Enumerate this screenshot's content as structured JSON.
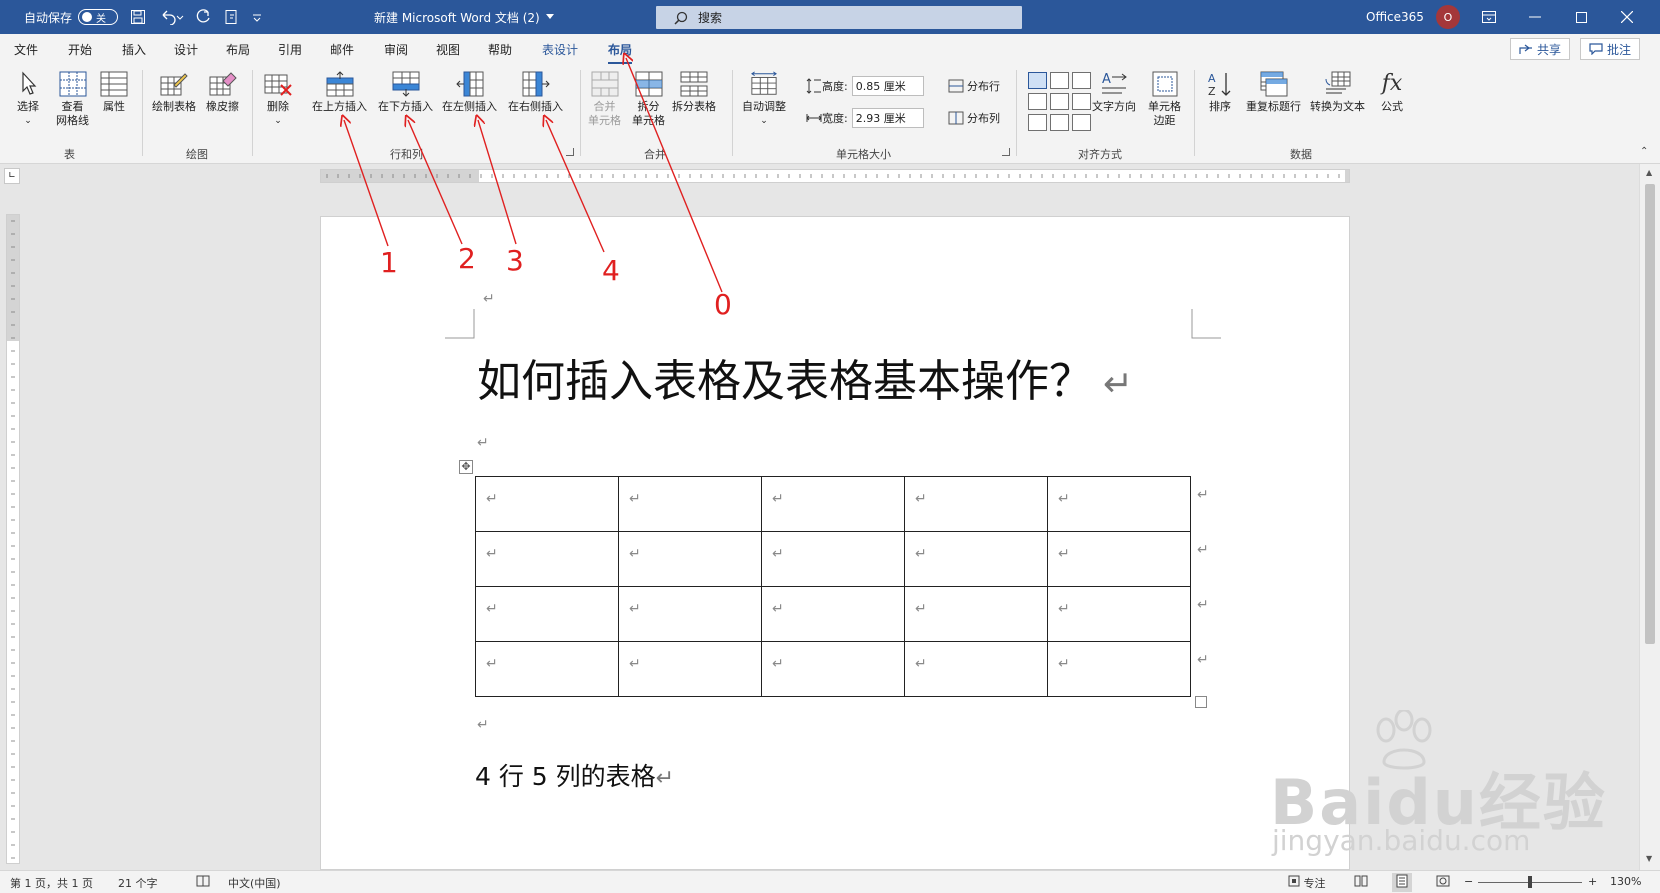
{
  "titlebar": {
    "autosave_label": "自动保存",
    "autosave_state": "关",
    "doc_title": "新建 Microsoft Word 文档 (2)",
    "search_placeholder": "搜索",
    "account": "Office365",
    "avatar_initial": "O"
  },
  "tabs": {
    "items": [
      "文件",
      "开始",
      "插入",
      "设计",
      "布局",
      "引用",
      "邮件",
      "审阅",
      "视图",
      "帮助",
      "表设计",
      "布局"
    ],
    "share": "共享",
    "comments": "批注"
  },
  "ribbon": {
    "table_group": {
      "label": "表",
      "select": "选择",
      "gridlines_1": "查看",
      "gridlines_2": "网格线",
      "properties": "属性"
    },
    "draw_group": {
      "label": "绘图",
      "draw_table": "绘制表格",
      "eraser": "橡皮擦"
    },
    "rows_cols_group": {
      "label": "行和列",
      "delete": "删除",
      "insert_above": "在上方插入",
      "insert_below": "在下方插入",
      "insert_left": "在左侧插入",
      "insert_right": "在右侧插入"
    },
    "merge_group": {
      "label": "合并",
      "merge_1": "合并",
      "merge_2": "单元格",
      "split_cells_1": "拆分",
      "split_cells_2": "单元格",
      "split_table": "拆分表格"
    },
    "cell_size_group": {
      "label": "单元格大小",
      "autofit": "自动调整",
      "height_label": "高度:",
      "height_value": "0.85 厘米",
      "width_label": "宽度:",
      "width_value": "2.93 厘米",
      "distribute_rows": "分布行",
      "distribute_cols": "分布列"
    },
    "alignment_group": {
      "label": "对齐方式",
      "text_direction": "文字方向",
      "cell_margins_1": "单元格",
      "cell_margins_2": "边距"
    },
    "data_group": {
      "label": "数据",
      "sort": "排序",
      "repeat_header": "重复标题行",
      "convert_text": "转换为文本",
      "formula": "公式"
    }
  },
  "document": {
    "title": "如何插入表格及表格基本操作？",
    "para_mark": "↵",
    "table": {
      "rows": 4,
      "cols": 5,
      "cell_text": "↵"
    },
    "caption": "4 行 5 列的表格"
  },
  "annotations": [
    "1",
    "2",
    "3",
    "4",
    "0"
  ],
  "watermark": {
    "main": "Baidu经验",
    "sub": "jingyan.baidu.com"
  },
  "statusbar": {
    "page": "第 1 页，共 1 页",
    "words": "21 个字",
    "language": "中文(中国)",
    "focus": "专注",
    "zoom": "130%"
  },
  "colors": {
    "brand": "#2b579a",
    "annotation": "#e02020"
  }
}
